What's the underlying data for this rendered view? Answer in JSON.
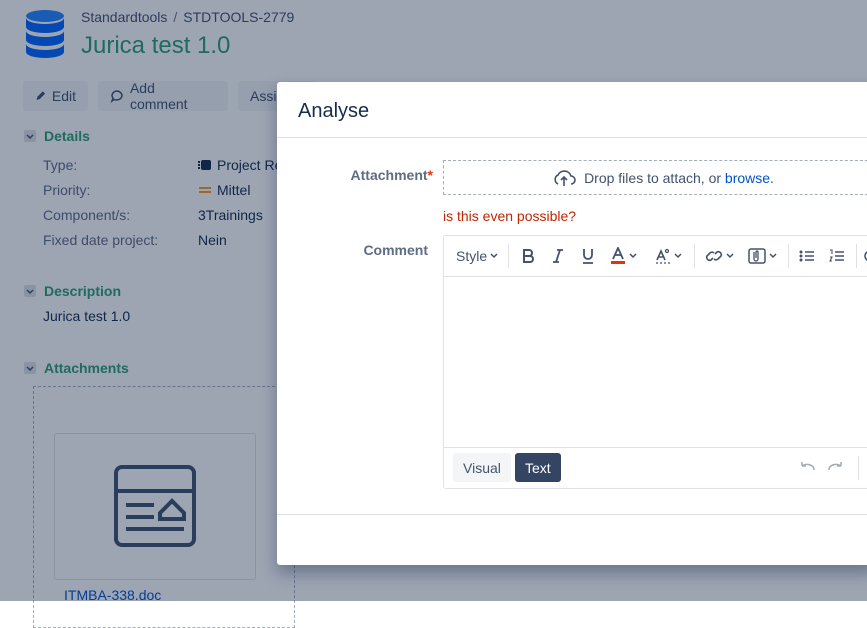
{
  "breadcrumb": {
    "project": "Standardtools",
    "issue_key": "STDTOOLS-2779"
  },
  "issue": {
    "title": "Jurica test 1.0"
  },
  "toolbar": {
    "edit": "Edit",
    "add_comment": "Add comment",
    "assign": "Assig"
  },
  "details": {
    "heading": "Details",
    "fields": [
      {
        "label": "Type:",
        "value": "Project Re"
      },
      {
        "label": "Priority:",
        "value": "Mittel"
      },
      {
        "label": "Component/s:",
        "value": "3Trainings"
      },
      {
        "label": "Fixed date project:",
        "value": "Nein"
      }
    ]
  },
  "description": {
    "heading": "Description",
    "text": "Jurica test 1.0"
  },
  "attachments": {
    "heading": "Attachments",
    "file_name": "ITMBA-338.doc"
  },
  "dialog": {
    "title": "Analyse",
    "attachment_label": "Attachment",
    "required_mark": "*",
    "drop_text": "Drop files to attach, or",
    "browse_link": "browse.",
    "error_text": "is this even possible?",
    "comment_label": "Comment",
    "editor": {
      "style_label": "Style",
      "mode_visual": "Visual",
      "mode_text": "Text"
    }
  },
  "colors": {
    "accent_green": "#2e9e6e",
    "link_blue": "#0052cc",
    "error_red": "#bf2600",
    "dark_button": "#344563"
  }
}
